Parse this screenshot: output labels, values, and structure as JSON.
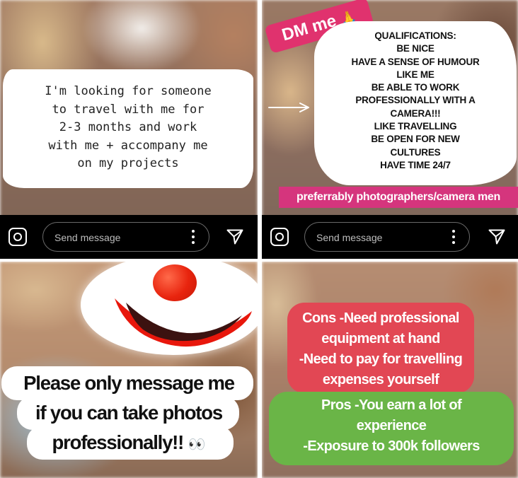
{
  "panel1": {
    "story_text": "I'm looking for someone\nto travel with me for\n2-3 months and work\nwith me + accompany me\non my projects",
    "message_bar": {
      "placeholder": "Send message"
    }
  },
  "panel2": {
    "sticker": {
      "text": "DM me",
      "emoji": "🙏"
    },
    "qualifications": [
      "QUALIFICATIONS:",
      "BE NICE",
      "HAVE A SENSE OF HUMOUR",
      "LIKE ME",
      "BE ABLE TO WORK",
      "PROFESSIONALLY WITH A",
      "CAMERA!!!",
      "LIKE TRAVELLING",
      "BE OPEN FOR NEW",
      "CULTURES",
      "HAVE TIME 24/7"
    ],
    "highlight": "preferrably photographers/camera men",
    "message_bar": {
      "placeholder": "Send message"
    }
  },
  "panel3": {
    "lines": [
      "Please only message me",
      "if you can take photos",
      "professionally!!"
    ],
    "emoji": "👀"
  },
  "panel4": {
    "cons_lines": [
      "Cons -Need professional",
      "equipment at hand",
      "-Need to pay for travelling",
      "expenses yourself"
    ],
    "pros_lines": [
      "Pros -You earn a lot of",
      "experience",
      "-Exposure to 300k followers"
    ]
  },
  "colors": {
    "pink_sticker": "#e0326e",
    "pink_strip": "#d5357d",
    "cons_red": "#e24754",
    "pros_green": "#6ab547",
    "bar_black": "#000000"
  },
  "icons": [
    "camera-icon",
    "more-vertical-icon",
    "send-icon",
    "arrow-right-icon",
    "clown-emoji-icon"
  ]
}
